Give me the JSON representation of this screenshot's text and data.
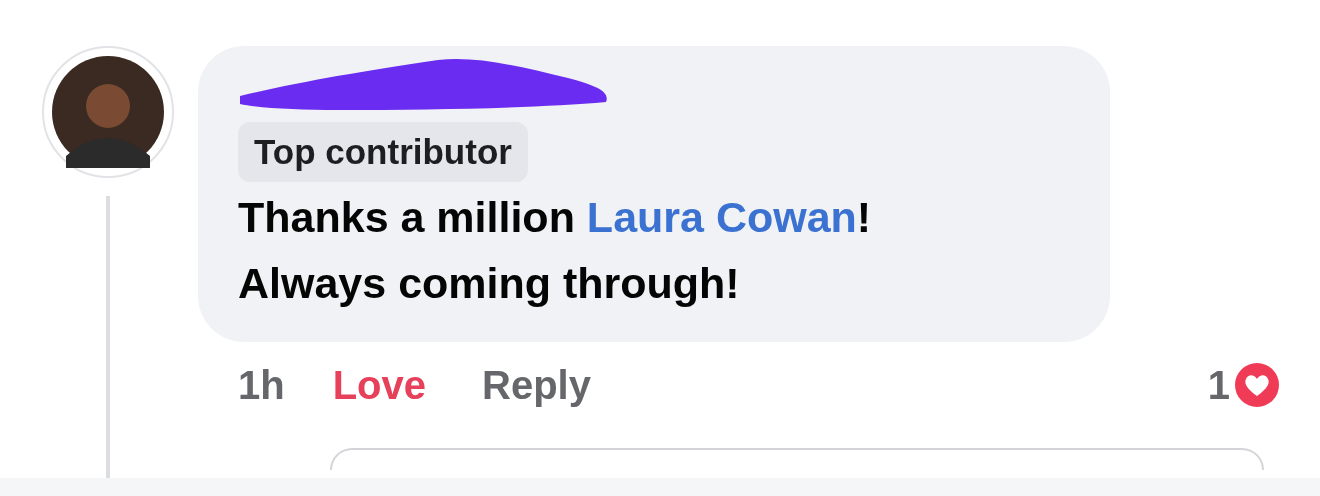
{
  "comment": {
    "badge": "Top contributor",
    "lines": [
      [
        {
          "kind": "text",
          "text": "Thanks a million "
        },
        {
          "kind": "mention",
          "text": "Laura Cowan"
        },
        {
          "kind": "text",
          "text": "!"
        }
      ],
      [
        {
          "kind": "text",
          "text": "Always coming through!"
        }
      ]
    ],
    "time": "1h",
    "love": {
      "label": "Love",
      "selected": true
    },
    "reply": {
      "label": "Reply"
    },
    "reaction_count": "1"
  }
}
